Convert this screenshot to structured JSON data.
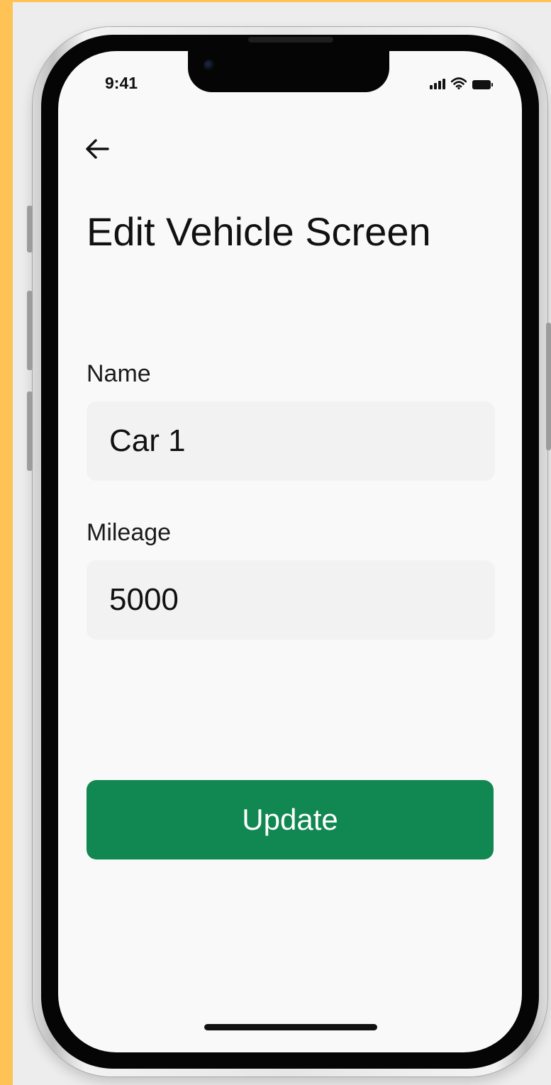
{
  "status_bar": {
    "time": "9:41",
    "icons": [
      "signal-icon",
      "wifi-icon",
      "battery-icon"
    ]
  },
  "header": {
    "back_icon": "back-arrow-icon",
    "title": "Edit Vehicle Screen"
  },
  "form": {
    "name": {
      "label": "Name",
      "value": "Car 1"
    },
    "mileage": {
      "label": "Mileage",
      "value": "5000"
    }
  },
  "actions": {
    "update_label": "Update"
  },
  "colors": {
    "frame": "#ffc255",
    "primary_button": "#118751",
    "input_background": "#f2f2f2",
    "screen_background": "#f9f9f9"
  }
}
